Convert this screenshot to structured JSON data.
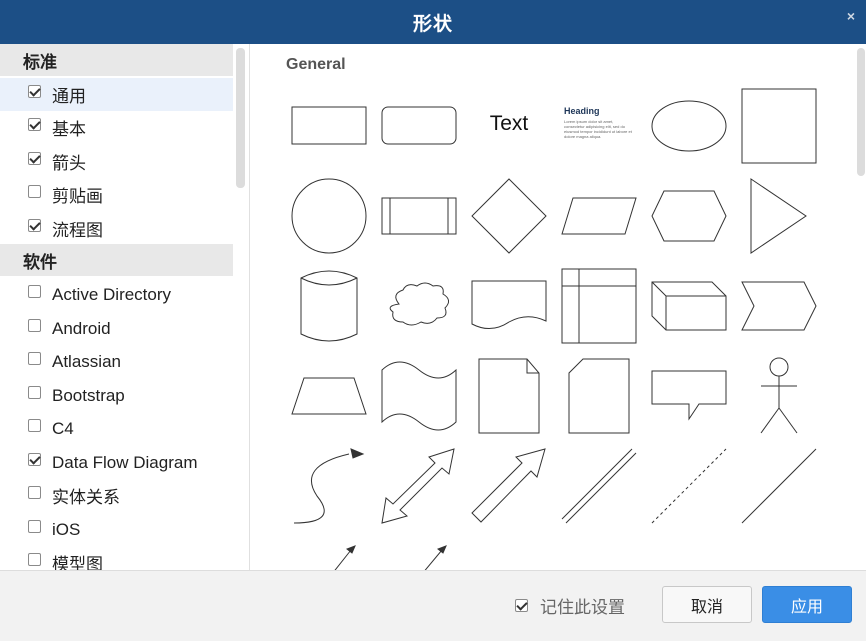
{
  "dialog": {
    "title": "形状",
    "close_glyph": "×"
  },
  "sidebar": {
    "groups": [
      {
        "header": "标准",
        "items": [
          {
            "label": "通用",
            "checked": true,
            "selected": true
          },
          {
            "label": "基本",
            "checked": true
          },
          {
            "label": "箭头",
            "checked": true
          },
          {
            "label": "剪贴画",
            "checked": false
          },
          {
            "label": "流程图",
            "checked": true
          }
        ]
      },
      {
        "header": "软件",
        "items": [
          {
            "label": "Active Directory",
            "checked": false
          },
          {
            "label": "Android",
            "checked": false
          },
          {
            "label": "Atlassian",
            "checked": false
          },
          {
            "label": "Bootstrap",
            "checked": false
          },
          {
            "label": "C4",
            "checked": false
          },
          {
            "label": "Data Flow Diagram",
            "checked": true
          },
          {
            "label": "实体关系",
            "checked": false
          },
          {
            "label": "iOS",
            "checked": false
          },
          {
            "label": "模型图",
            "checked": false
          }
        ]
      }
    ]
  },
  "main": {
    "section_title": "General",
    "text_shape_label": "Text",
    "heading_shape_title": "Heading",
    "heading_shape_body": "Lorem ipsum dolor sit amet, consectetur adipisicing elit, sed do eiusmod tempor incididunt ut labore et dolore magna aliqua.",
    "shapes": [
      "rectangle",
      "rounded-rectangle",
      "text",
      "textbox",
      "ellipse",
      "square",
      "circle",
      "process",
      "diamond",
      "parallelogram",
      "hexagon",
      "triangle",
      "cylinder",
      "cloud",
      "document",
      "internal-storage",
      "cube",
      "step",
      "trapezoid",
      "tape",
      "note",
      "card",
      "callout",
      "actor",
      "curved-arrow",
      "bidirectional-arrow",
      "arrow",
      "link",
      "dashed-line",
      "line",
      "connector-arrow",
      "connector-arrow-2"
    ]
  },
  "footer": {
    "remember_label": "记住此设置",
    "remember_checked": true,
    "cancel_label": "取消",
    "apply_label": "应用"
  },
  "colors": {
    "titlebar": "#1c4f86",
    "apply": "#3a8ee6",
    "selected_row": "#eaf1fb"
  }
}
